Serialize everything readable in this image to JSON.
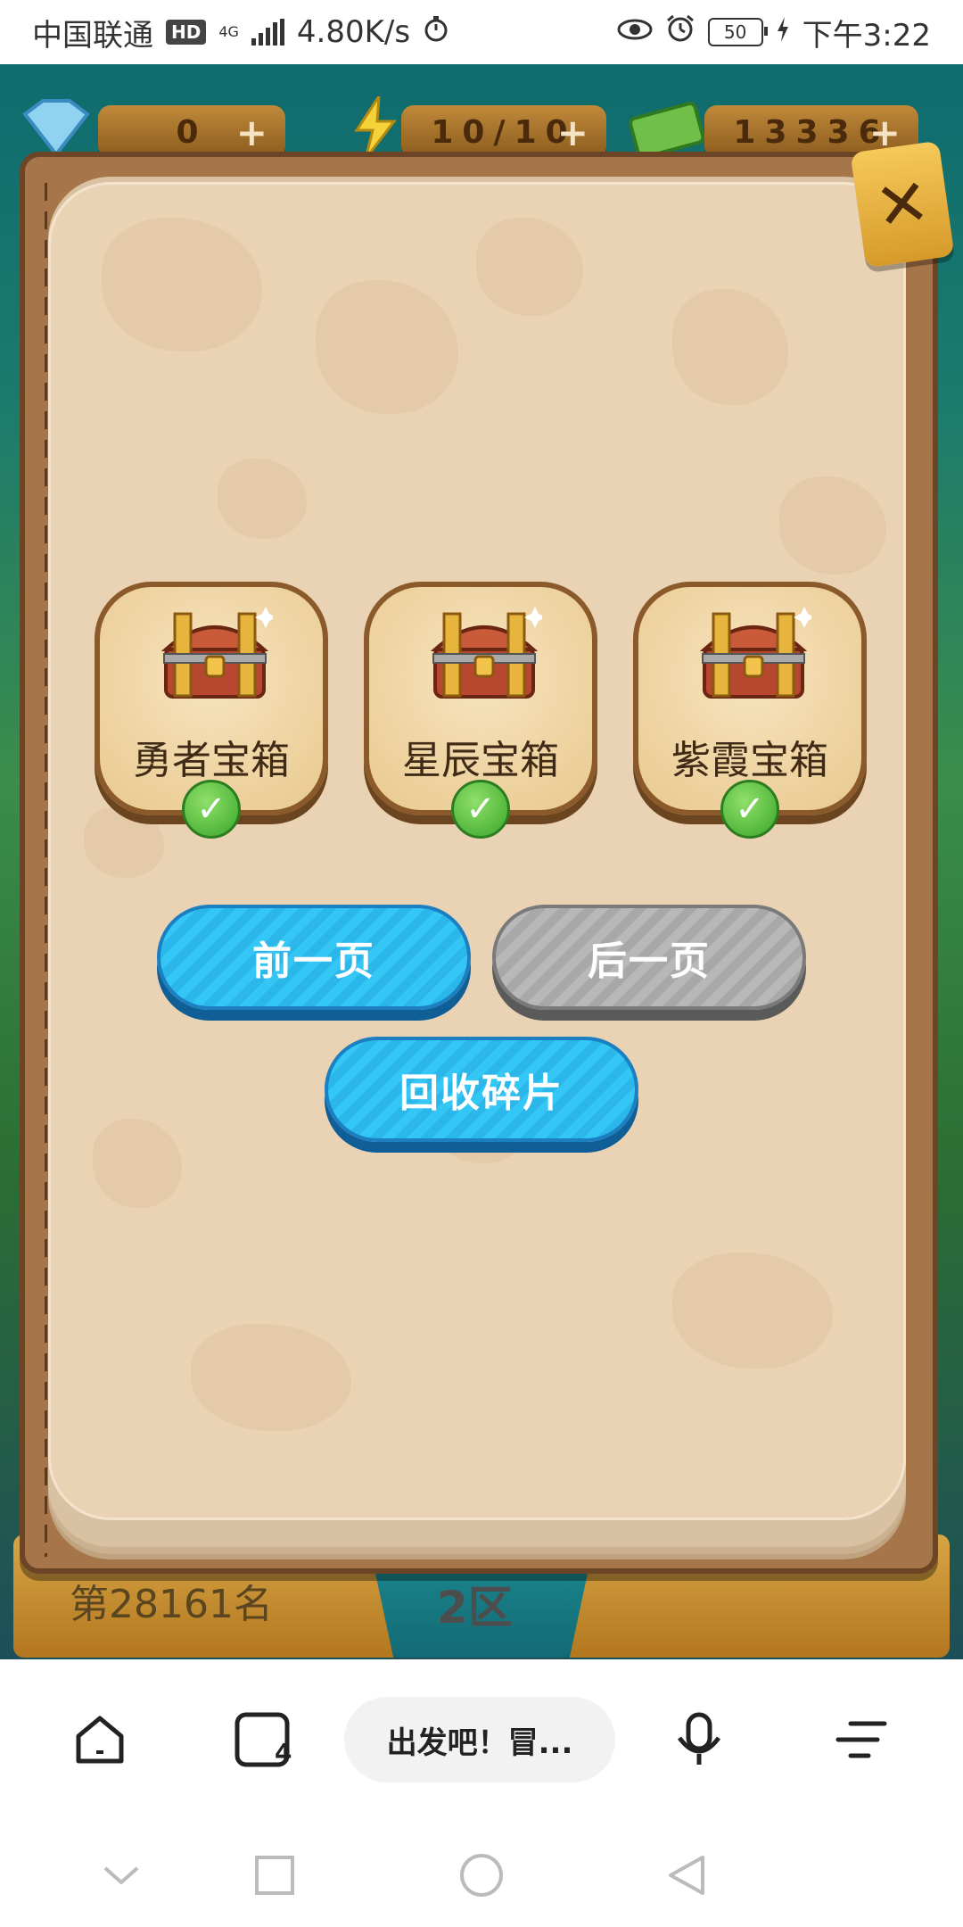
{
  "status_bar": {
    "carrier": "中国联通",
    "hd": "HD",
    "network": "4G",
    "speed": "4.80K/s",
    "battery": "50",
    "time": "下午3:22"
  },
  "hud": {
    "gems": "0",
    "energy": "10/10",
    "cash": "13336"
  },
  "dialog": {
    "chests": [
      {
        "label": "勇者宝箱",
        "checked": true
      },
      {
        "label": "星辰宝箱",
        "checked": true
      },
      {
        "label": "紫霞宝箱",
        "checked": true
      }
    ],
    "prev_label": "前一页",
    "next_label": "后一页",
    "recycle_label": "回收碎片"
  },
  "game_footer": {
    "rank": "第28161名",
    "zone": "2区"
  },
  "browser": {
    "tab_title": "出发吧！冒...",
    "tab_count": "4"
  },
  "colors": {
    "blue_button": "#2bb7ea",
    "gray_button": "#a8a8a8",
    "panel": "#ead3b4",
    "check": "#3aa62a"
  }
}
